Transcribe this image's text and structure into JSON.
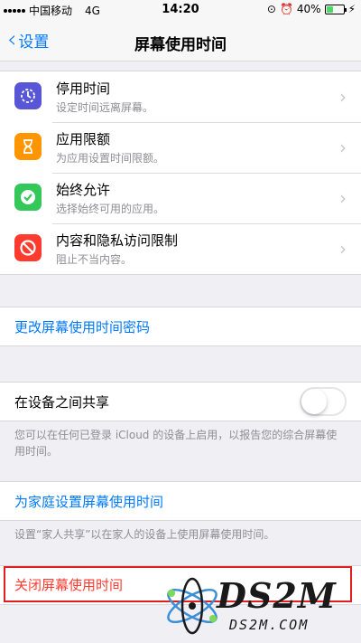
{
  "status_bar": {
    "carrier": "中国移动",
    "network": "4G",
    "time": "14:20",
    "battery": "40%",
    "battery_level": 0.4
  },
  "nav": {
    "back_label": "设置",
    "title": "屏幕使用时间"
  },
  "menu": [
    {
      "title": "停用时间",
      "subtitle": "设定时间远离屏幕。",
      "icon": "downtime-icon",
      "color": "#5856d6"
    },
    {
      "title": "应用限额",
      "subtitle": "为应用设置时间限额。",
      "icon": "hourglass-icon",
      "color": "#ff9500"
    },
    {
      "title": "始终允许",
      "subtitle": "选择始终可用的应用。",
      "icon": "checkmark-badge-icon",
      "color": "#34c759"
    },
    {
      "title": "内容和隐私访问限制",
      "subtitle": "阻止不当内容。",
      "icon": "restriction-icon",
      "color": "#ff3b30"
    }
  ],
  "change_passcode": "更改屏幕使用时间密码",
  "share": {
    "label": "在设备之间共享",
    "enabled": false,
    "footnote": "您可以在任何已登录 iCloud 的设备上启用，以报告您的综合屏幕使用时间。"
  },
  "family": {
    "label": "为家庭设置屏幕使用时间",
    "footnote": "设置“家人共享”以在家人的设备上使用屏幕使用时间。"
  },
  "turn_off": "关闭屏幕使用时间",
  "watermark": {
    "brand": "DS2M",
    "site": "DS2M.COM"
  }
}
